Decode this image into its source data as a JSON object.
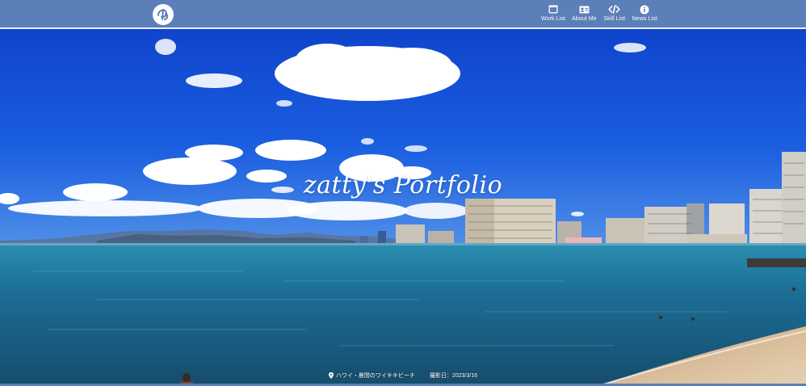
{
  "header": {
    "logo_icon": "logo-mark-icon",
    "nav": [
      {
        "label": "Work List",
        "icon": "browser-window-icon"
      },
      {
        "label": "About Me",
        "icon": "id-card-icon"
      },
      {
        "label": "Skill List",
        "icon": "code-icon"
      },
      {
        "label": "News List",
        "icon": "info-circle-icon"
      }
    ]
  },
  "hero": {
    "title": "zatty's Portfolio",
    "location": "ハワイ・晨間のワイキキビーチ",
    "location_icon": "map-pin-icon",
    "date": "撮影日：2023/3/16"
  },
  "colors": {
    "header_bg": "#5b7fb8",
    "sky": "#1a55d8",
    "ocean": "#1f6f9e"
  }
}
